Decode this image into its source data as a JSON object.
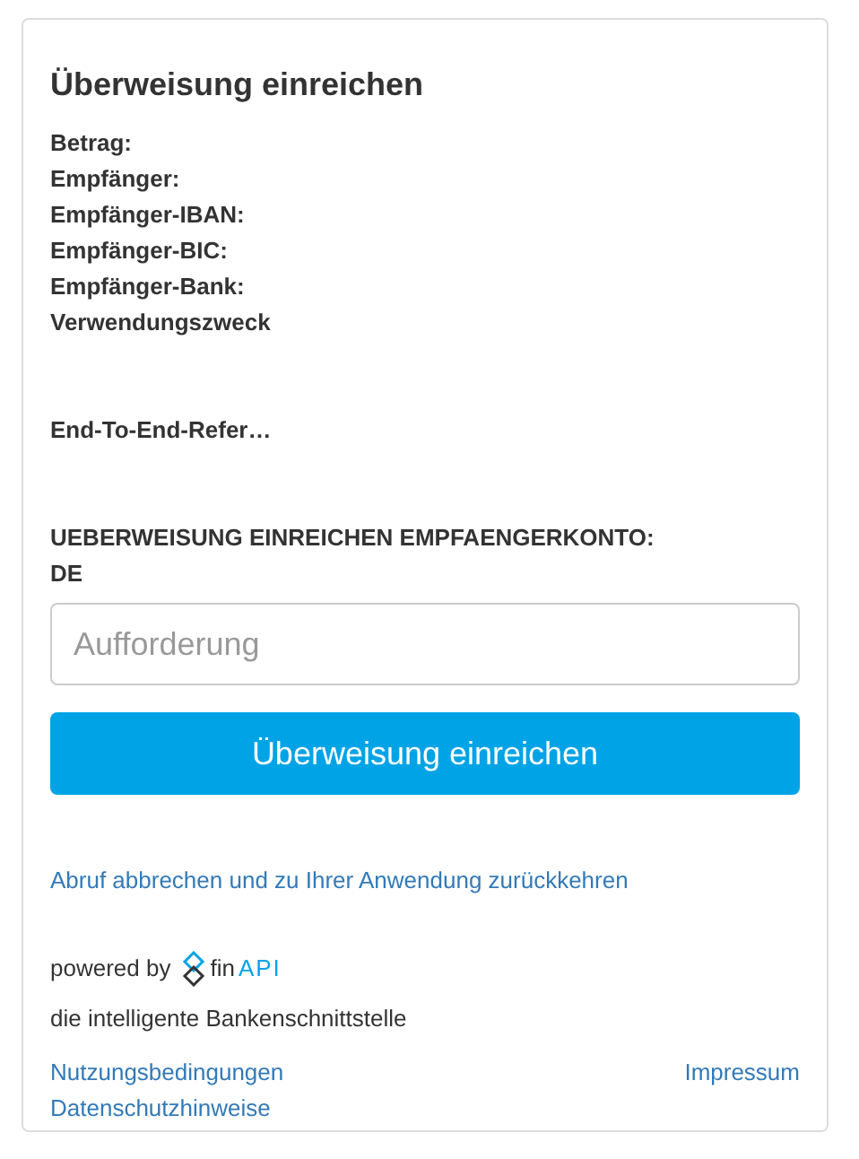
{
  "title": "Überweisung einreichen",
  "details": [
    "Betrag:",
    "Empfänger:",
    "Empfänger-IBAN:",
    "Empfänger-BIC:",
    "Empfänger-Bank:",
    "Verwendungszweck"
  ],
  "reference_label": "End-To-End-Refer…",
  "account_heading": "UEBERWEISUNG EINREICHEN EMPFAENGERKONTO:",
  "account_value": "DE",
  "input": {
    "placeholder": "Aufforderung"
  },
  "submit_button": "Überweisung einreichen",
  "cancel_link": "Abruf abbrechen und zu Ihrer Anwendung zurückkehren",
  "powered_by": "powered by",
  "logo": {
    "part_1": "fin",
    "part_2": "API"
  },
  "tagline": "die intelligente Bankenschnittstelle",
  "footer_links": [
    "Nutzungsbedingungen",
    "Impressum",
    "Datenschutzhinweise"
  ]
}
